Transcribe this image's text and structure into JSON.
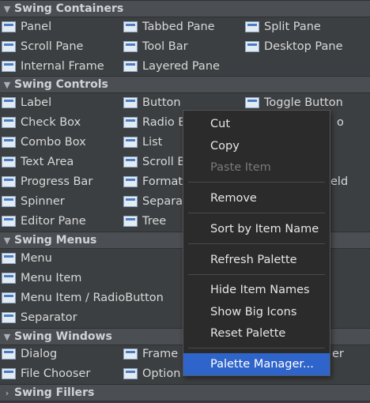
{
  "categories": {
    "containers": "Swing Containers",
    "controls": "Swing Controls",
    "menus": "Swing Menus",
    "windows": "Swing Windows",
    "fillers": "Swing Fillers"
  },
  "containers": [
    "Panel",
    "Tabbed Pane",
    "Split Pane",
    "Scroll Pane",
    "Tool Bar",
    "Desktop Pane",
    "Internal Frame",
    "Layered Pane"
  ],
  "controls": [
    "Label",
    "Button",
    "Toggle Button",
    "Check Box",
    "Radio B",
    "Combo Box",
    "List",
    "Text Area",
    "Scroll B",
    "Progress Bar",
    "Formatt",
    "Spinner",
    "Separat",
    "Editor Pane",
    "Tree"
  ],
  "controls_clipped": [
    "o",
    "eld"
  ],
  "menus": [
    "Menu",
    "Menu Item",
    "Menu Item / RadioButton",
    "Separator"
  ],
  "windows": [
    "Dialog",
    "Frame",
    "File Chooser",
    "Option",
    "er"
  ],
  "context_menu": {
    "cut": "Cut",
    "copy": "Copy",
    "paste": "Paste Item",
    "remove": "Remove",
    "sort": "Sort by Item Name",
    "refresh": "Refresh Palette",
    "hide": "Hide Item Names",
    "big_icons": "Show Big Icons",
    "reset": "Reset Palette",
    "manager": "Palette Manager..."
  },
  "colors": {
    "background": "#3c3f41",
    "menu_bg": "#2b2b2b",
    "selection": "#2f65ca"
  }
}
